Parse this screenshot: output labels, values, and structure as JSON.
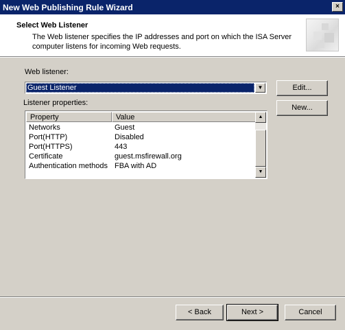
{
  "window": {
    "title": "New Web Publishing Rule Wizard",
    "close_glyph": "×"
  },
  "header": {
    "heading": "Select Web Listener",
    "description": "The Web listener specifies the IP addresses and port on which the ISA Server computer listens for incoming Web requests."
  },
  "listener": {
    "label": "Web listener:",
    "selected": "Guest Listener",
    "edit_button": "Edit...",
    "new_button": "New..."
  },
  "properties": {
    "label": "Listener properties:",
    "columns": [
      "Property",
      "Value"
    ],
    "rows": [
      [
        "Networks",
        "Guest"
      ],
      [
        "Port(HTTP)",
        "Disabled"
      ],
      [
        "Port(HTTPS)",
        "443"
      ],
      [
        "Certificate",
        "guest.msfirewall.org"
      ],
      [
        "Authentication methods",
        "FBA with AD"
      ]
    ]
  },
  "footer": {
    "back_button": "< Back",
    "next_button": "Next >",
    "cancel_button": "Cancel"
  }
}
